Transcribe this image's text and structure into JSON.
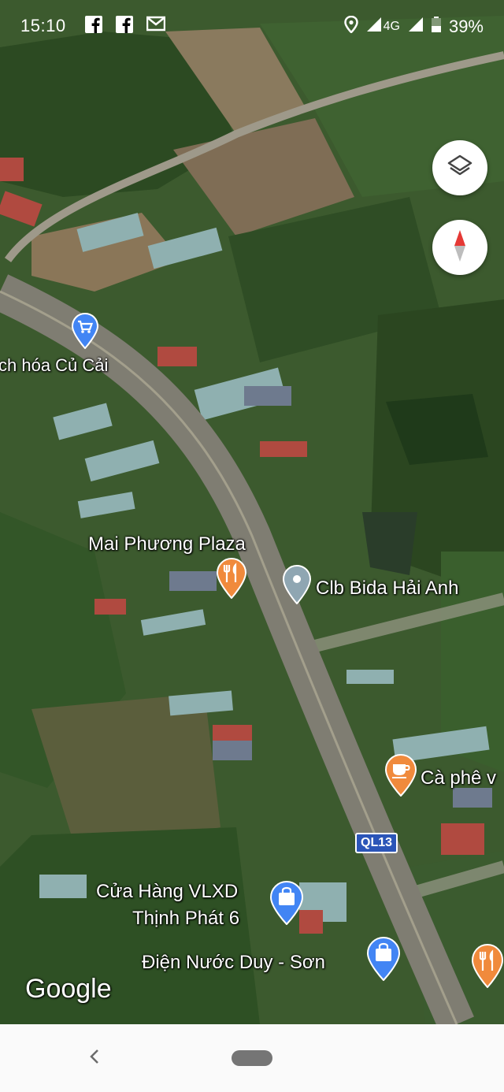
{
  "status_bar": {
    "time": "15:10",
    "notification_icons": [
      "facebook-icon",
      "facebook-icon",
      "gmail-icon"
    ],
    "network": "4G",
    "battery": "39%"
  },
  "map_controls": {
    "layers_icon": "layers-icon",
    "compass_icon": "compass-icon"
  },
  "places": [
    {
      "name": "ch hóa Củ Cải",
      "type": "shopping"
    },
    {
      "name": "Mai Phương Plaza",
      "type": "restaurant"
    },
    {
      "name": "Clb Bida Hải Anh",
      "type": "generic"
    },
    {
      "name": "Cà phê v",
      "type": "cafe"
    },
    {
      "name_line1": "Cửa Hàng VLXD",
      "name_line2": "Thịnh Phát 6",
      "type": "shopping"
    },
    {
      "name": "Điện Nước Duy - Sơn",
      "type": "shopping"
    }
  ],
  "road_shield": "QL13",
  "attribution": "Google",
  "colors": {
    "shopping_pin": "#4285f4",
    "restaurant_pin": "#f08a3c",
    "generic_pin": "#8fa6b2",
    "road_shield": "#2b55b8"
  }
}
